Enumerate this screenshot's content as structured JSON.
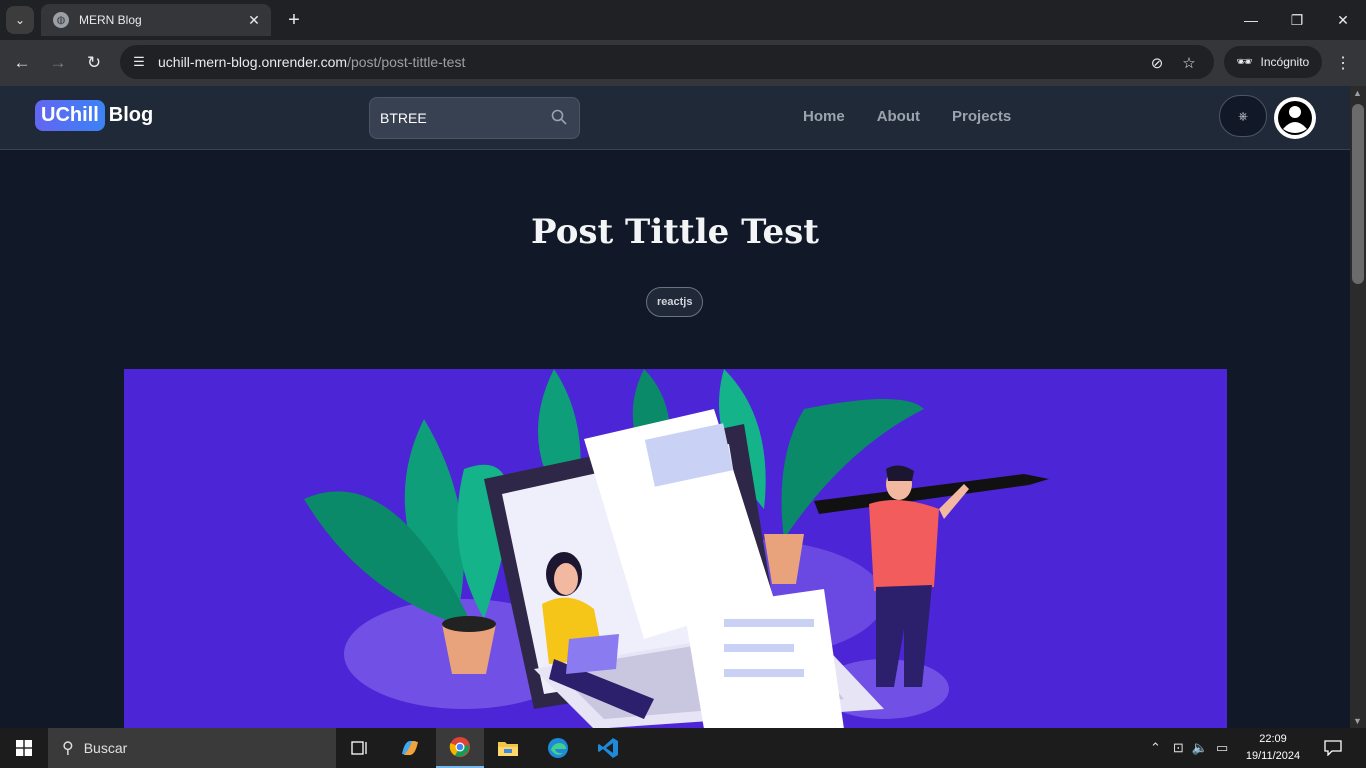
{
  "browser": {
    "tab_title": "MERN Blog",
    "url_host": "uchill-mern-blog.onrender.com",
    "url_path": "/post/post-tittle-test",
    "incognito_label": "Incógnito"
  },
  "site": {
    "logo_badge": "UChill",
    "logo_word": "Blog",
    "search_value": "BTREE",
    "nav": [
      "Home",
      "About",
      "Projects"
    ],
    "theme_icon": "⎈"
  },
  "post": {
    "title": "Post Tittle Test",
    "tag": "reactjs"
  },
  "taskbar": {
    "search_placeholder": "Buscar",
    "time": "22:09",
    "date": "19/11/2024"
  },
  "colors": {
    "page_bg": "#111827",
    "header_bg": "#1f2937",
    "hero_bg": "#4c25d6",
    "logo_gradient_start": "#6366f1",
    "logo_gradient_end": "#3b82f6"
  }
}
